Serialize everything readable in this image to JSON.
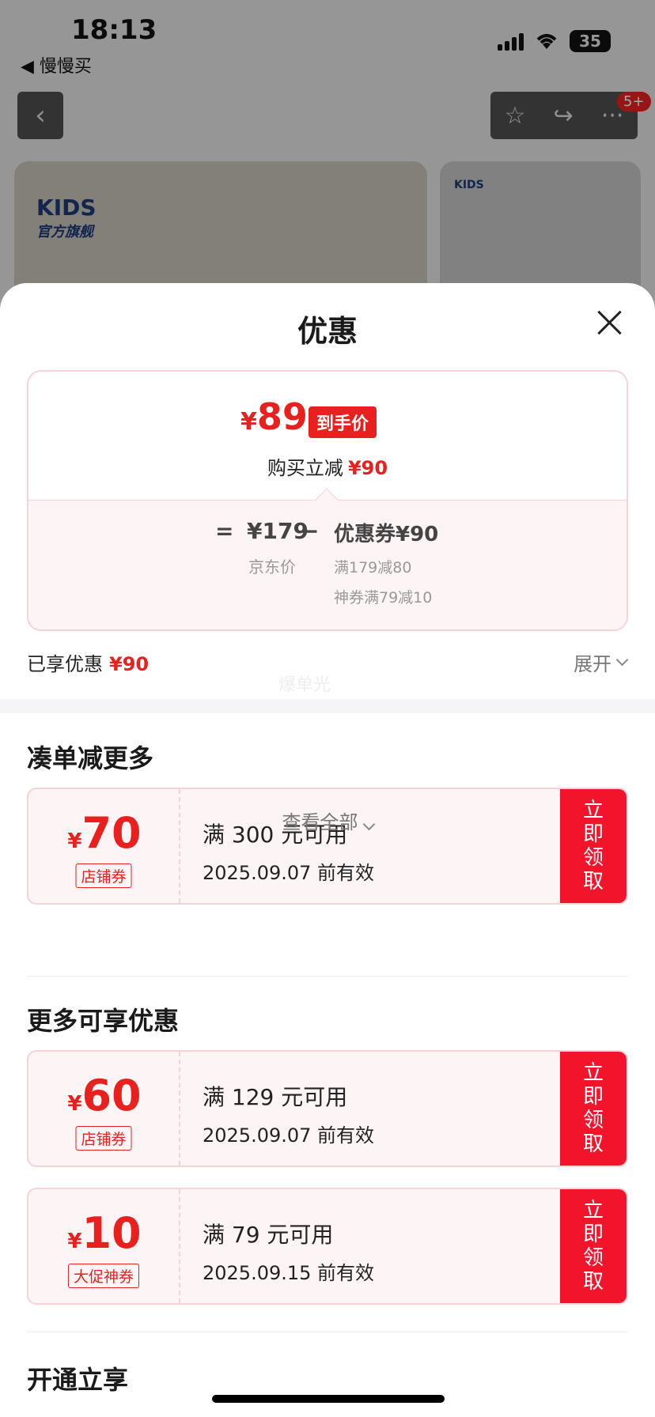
{
  "status": {
    "time": "18:13",
    "battery": "35",
    "back_app": "◀ 慢慢买"
  },
  "nav": {
    "back_icon": "‹",
    "star_icon": "☆",
    "share_icon": "↪",
    "more_icon": "···",
    "badge": "5+"
  },
  "banner": {
    "brand": "KIDS",
    "brand_sub": "官方旗舰"
  },
  "sheet": {
    "title": "优惠",
    "price_card": {
      "final_yen": "¥",
      "final_price": "89",
      "final_tag": "到手价",
      "buy_text": "购买立减",
      "buy_amount": "¥90",
      "eq": "=",
      "jd_price": "¥179",
      "minus": "−",
      "coupon_text": "优惠券¥90",
      "jd_label": "京东价",
      "detail1": "满179减80",
      "detail2": "神券满79减10"
    },
    "enjoyed_label": "已享优惠",
    "enjoyed_amount": "¥90",
    "expand_label": "展开",
    "ghost_text": "爆单光"
  },
  "sections": {
    "combine": {
      "title": "凑单减更多",
      "coupons": [
        {
          "yen": "¥",
          "amount": "70",
          "tag": "店铺券",
          "cond": "满 300 元可用",
          "date": "2025.09.07 前有效",
          "btn": "立即领取"
        }
      ],
      "view_all": "查看全部"
    },
    "more": {
      "title": "更多可享优惠",
      "coupons": [
        {
          "yen": "¥",
          "amount": "60",
          "tag": "店铺券",
          "cond": "满 129 元可用",
          "date": "2025.09.07 前有效",
          "btn": "立即领取"
        },
        {
          "yen": "¥",
          "amount": "10",
          "tag": "大促神券",
          "cond": "满 79 元可用",
          "date": "2025.09.15 前有效",
          "btn": "立即领取"
        }
      ]
    },
    "open": {
      "title": "开通立享"
    }
  },
  "colors": {
    "accent": "#e8211f",
    "button": "#f2142b",
    "card_border": "#f6d3d9",
    "card_bg": "#fdf4f5"
  }
}
